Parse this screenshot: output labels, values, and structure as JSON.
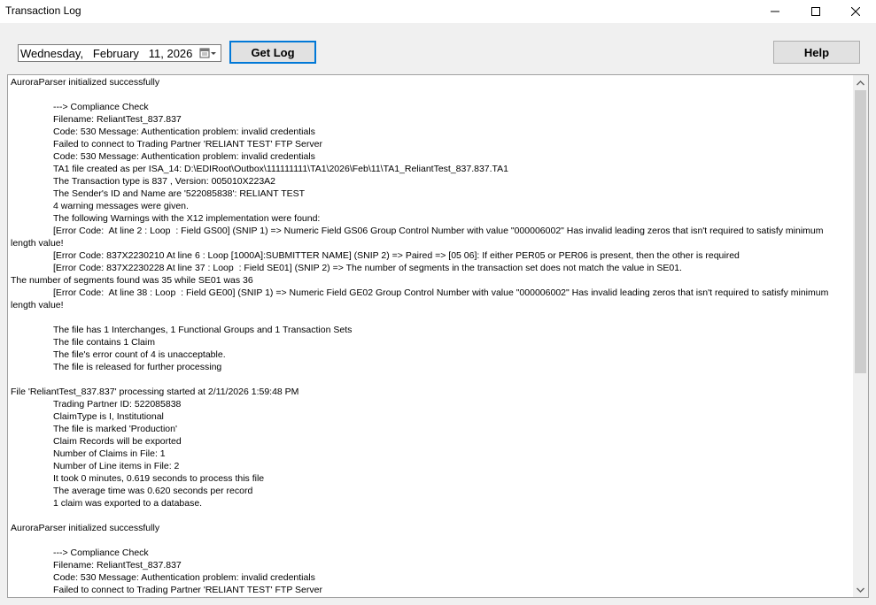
{
  "window": {
    "title": "Transaction Log",
    "minimize_icon": "minimize-icon",
    "maximize_icon": "maximize-icon",
    "close_icon": "close-icon"
  },
  "toolbar": {
    "date_value": "Wednesday,   February   11, 2026",
    "calendar_icon": "calendar-dropdown-icon",
    "get_log_label": "Get Log",
    "help_label": "Help"
  },
  "log": {
    "lines": [
      {
        "text": "AuroraParser initialized successfully",
        "indent": false
      },
      {
        "text": "",
        "indent": false
      },
      {
        "text": "---> Compliance Check",
        "indent": true
      },
      {
        "text": "Filename: ReliantTest_837.837",
        "indent": true
      },
      {
        "text": "Code: 530 Message: Authentication problem: invalid credentials",
        "indent": true
      },
      {
        "text": "Failed to connect to Trading Partner 'RELIANT TEST' FTP Server",
        "indent": true
      },
      {
        "text": "Code: 530 Message: Authentication problem: invalid credentials",
        "indent": true
      },
      {
        "text": "TA1 file created as per ISA_14: D:\\EDIRoot\\Outbox\\111111111\\TA1\\2026\\Feb\\11\\TA1_ReliantTest_837.837.TA1",
        "indent": true
      },
      {
        "text": "The Transaction type is 837 , Version: 005010X223A2",
        "indent": true
      },
      {
        "text": "The Sender's ID and Name are '522085838': RELIANT TEST",
        "indent": true
      },
      {
        "text": "4 warning messages were given.",
        "indent": true
      },
      {
        "text": "The following Warnings with the X12 implementation were found:",
        "indent": true
      },
      {
        "text": "[Error Code:  At line 2 : Loop  : Field GS00] (SNIP 1) => Numeric Field GS06 Group Control Number with value \"000006002\" Has invalid leading zeros that isn't required to satisfy minimum",
        "indent": true
      },
      {
        "text": "length value!",
        "indent": false
      },
      {
        "text": "[Error Code: 837X2230210 At line 6 : Loop [1000A]:SUBMITTER NAME] (SNIP 2) => Paired => [05 06]: If either PER05 or PER06 is present, then the other is required",
        "indent": true
      },
      {
        "text": "[Error Code: 837X2230228 At line 37 : Loop  : Field SE01] (SNIP 2) => The number of segments in the transaction set does not match the value in SE01.",
        "indent": true
      },
      {
        "text": "The number of segments found was 35 while SE01 was 36",
        "indent": false
      },
      {
        "text": "[Error Code:  At line 38 : Loop  : Field GE00] (SNIP 1) => Numeric Field GE02 Group Control Number with value \"000006002\" Has invalid leading zeros that isn't required to satisfy minimum",
        "indent": true
      },
      {
        "text": "length value!",
        "indent": false
      },
      {
        "text": "",
        "indent": false
      },
      {
        "text": "The file has 1 Interchanges, 1 Functional Groups and 1 Transaction Sets",
        "indent": true
      },
      {
        "text": "The file contains 1 Claim",
        "indent": true
      },
      {
        "text": "The file's error count of 4 is unacceptable.",
        "indent": true
      },
      {
        "text": "The file is released for further processing",
        "indent": true
      },
      {
        "text": "",
        "indent": false
      },
      {
        "text": "File 'ReliantTest_837.837' processing started at 2/11/2026 1:59:48 PM",
        "indent": false
      },
      {
        "text": "Trading Partner ID: 522085838",
        "indent": true
      },
      {
        "text": "ClaimType is I, Institutional",
        "indent": true
      },
      {
        "text": "The file is marked 'Production'",
        "indent": true
      },
      {
        "text": "Claim Records will be exported",
        "indent": true
      },
      {
        "text": "Number of Claims in File: 1",
        "indent": true
      },
      {
        "text": "Number of Line items in File: 2",
        "indent": true
      },
      {
        "text": "It took 0 minutes, 0.619 seconds to process this file",
        "indent": true
      },
      {
        "text": "The average time was 0.620 seconds per record",
        "indent": true
      },
      {
        "text": "1 claim was exported to a database.",
        "indent": true
      },
      {
        "text": "",
        "indent": false
      },
      {
        "text": "AuroraParser initialized successfully",
        "indent": false
      },
      {
        "text": "",
        "indent": false
      },
      {
        "text": "---> Compliance Check",
        "indent": true
      },
      {
        "text": "Filename: ReliantTest_837.837",
        "indent": true
      },
      {
        "text": "Code: 530 Message: Authentication problem: invalid credentials",
        "indent": true
      },
      {
        "text": "Failed to connect to Trading Partner 'RELIANT TEST' FTP Server",
        "indent": true
      }
    ]
  },
  "scrollbar": {
    "up_icon": "scroll-up-arrow-icon",
    "down_icon": "scroll-down-arrow-icon",
    "position": 0.0
  }
}
